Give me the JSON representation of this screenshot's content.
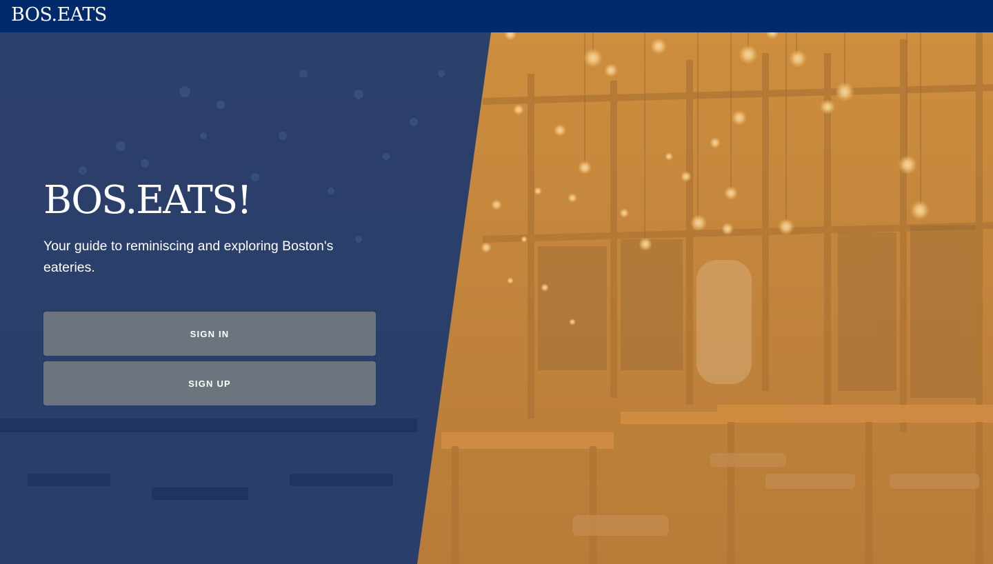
{
  "navbar": {
    "brand": "BOS.EATS"
  },
  "hero": {
    "title": "BOS.EATS!",
    "subtitle": "Your guide to reminiscing and exploring Boston's eateries.",
    "background_description_icon": "restaurant-interior-photo"
  },
  "buttons": {
    "sign_in": "SIGN IN",
    "sign_up": "SIGN UP"
  },
  "colors": {
    "navbar_bg": "#002a6c",
    "left_overlay": "#1f3a6e",
    "right_overlay": "#c98a3e",
    "button_bg": "#6c757d",
    "text": "#ffffff"
  }
}
